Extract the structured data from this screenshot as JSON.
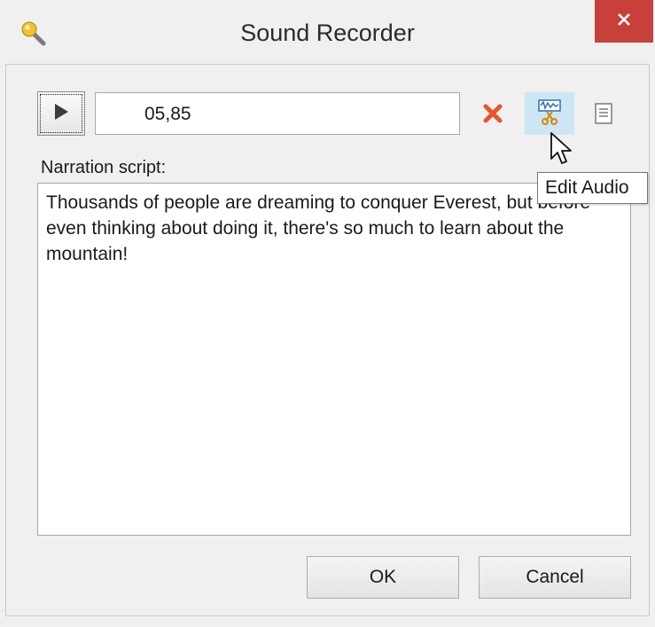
{
  "window": {
    "title": "Sound Recorder",
    "app_icon": "microphone-icon",
    "close_icon": "close-icon",
    "close_color": "#c7413a"
  },
  "toolbar": {
    "play_icon": "play-icon",
    "time_value": "05,85",
    "delete_icon": "delete-icon",
    "delete_color": "#e8542b",
    "edit_audio_icon": "edit-audio-icon",
    "script_icon": "script-icon"
  },
  "tooltip": {
    "text": "Edit Audio"
  },
  "narration": {
    "label": "Narration script:",
    "text": "Thousands of people are dreaming to conquer Everest, but before even thinking about doing it, there's so much to learn about the mountain!"
  },
  "buttons": {
    "ok_label": "OK",
    "cancel_label": "Cancel"
  }
}
